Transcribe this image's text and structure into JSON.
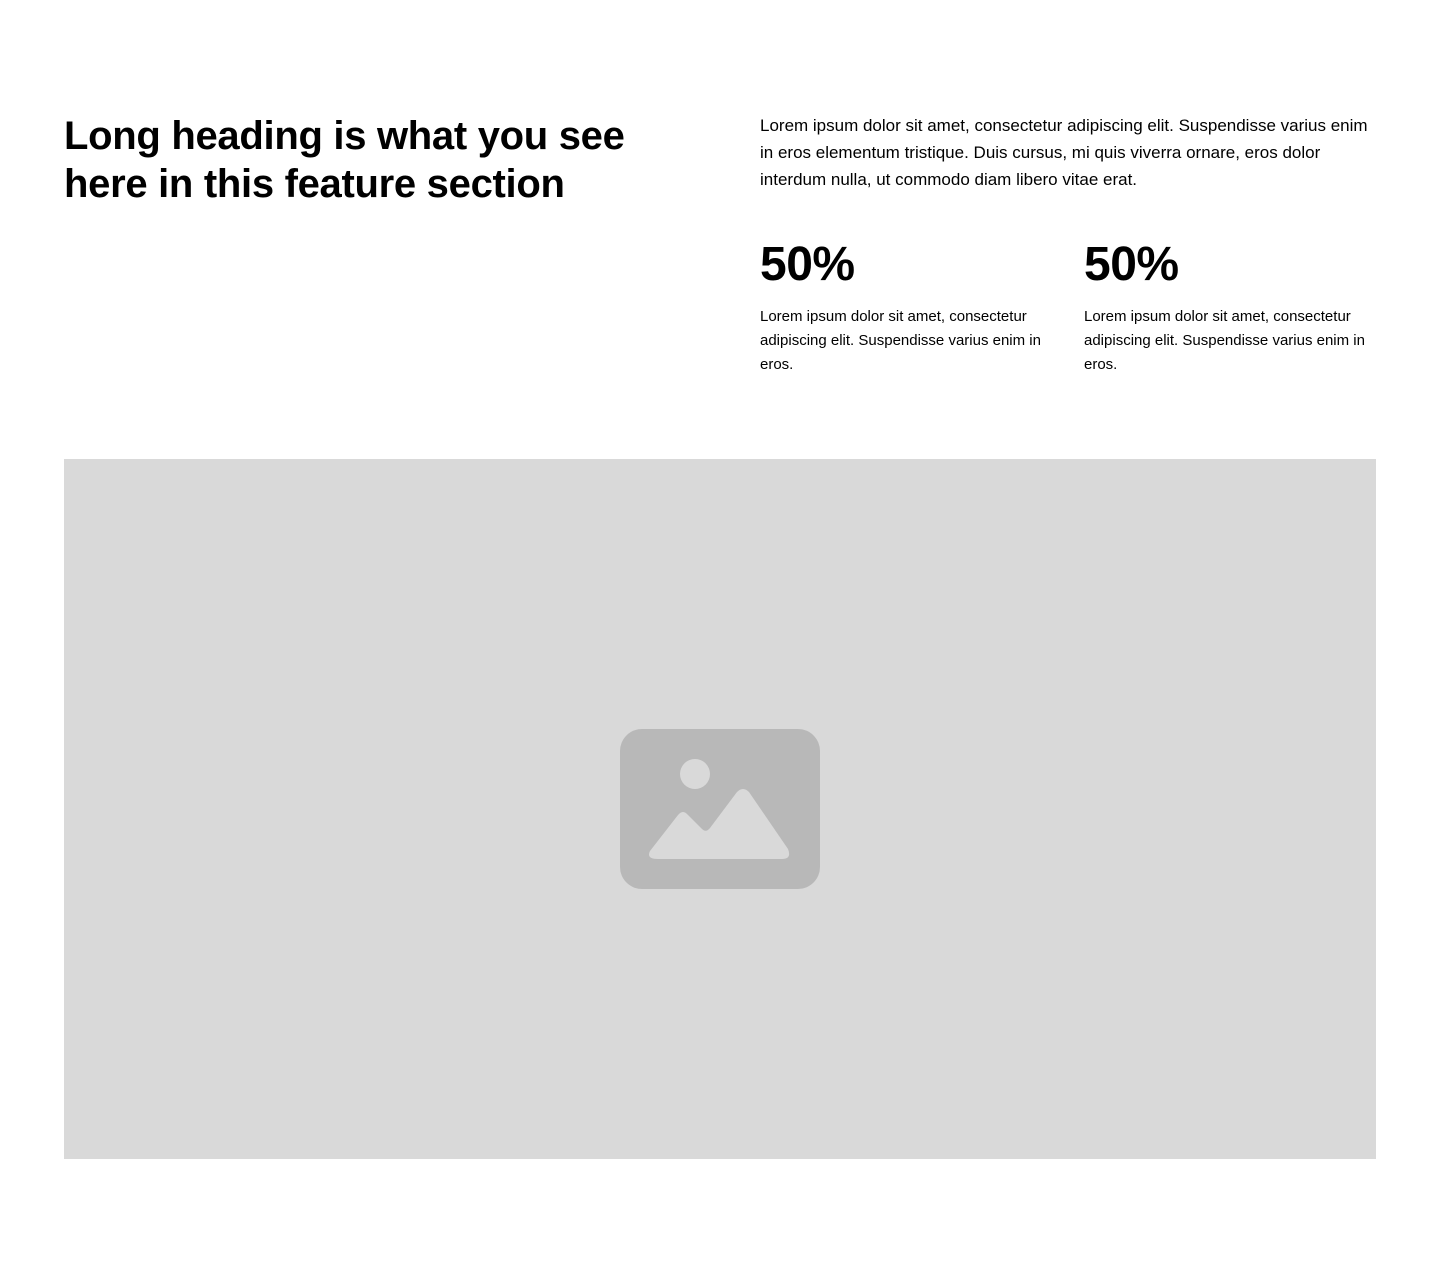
{
  "feature": {
    "heading": "Long heading is what you see here in this feature section",
    "intro": "Lorem ipsum dolor sit amet, consectetur adipiscing elit. Suspendisse varius enim in eros elementum tristique. Duis cursus, mi quis viverra ornare, eros dolor interdum nulla, ut commodo diam libero vitae erat.",
    "stats": [
      {
        "value": "50%",
        "description": "Lorem ipsum dolor sit amet, consectetur adipiscing elit. Suspendisse varius enim in eros."
      },
      {
        "value": "50%",
        "description": "Lorem ipsum dolor sit amet, consectetur adipiscing elit. Suspendisse varius enim in eros."
      }
    ]
  },
  "media": {
    "icon": "image-placeholder-icon",
    "background_color": "#d9d9d9",
    "icon_color": "#b8b8b8"
  }
}
